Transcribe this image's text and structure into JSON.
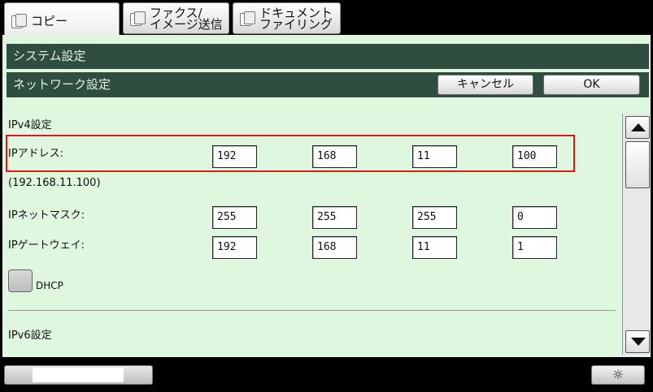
{
  "tabs": [
    {
      "label": "コピー"
    },
    {
      "label": "ファクス/\nイメージ送信"
    },
    {
      "label": "ドキュメント\nファイリング"
    }
  ],
  "header": {
    "system_settings": "システム設定",
    "network_settings": "ネットワーク設定",
    "cancel_label": "キャンセル",
    "ok_label": "OK"
  },
  "ipv4": {
    "section_title": "IPv4設定",
    "ip_address_label": "IPアドレス:",
    "ip_address": [
      "192",
      "168",
      "11",
      "100"
    ],
    "ip_address_display": "(192.168.11.100)",
    "subnet_mask_label": "IPネットマスク:",
    "subnet_mask": [
      "255",
      "255",
      "255",
      "0"
    ],
    "gateway_label": "IPゲートウェイ:",
    "gateway": [
      "192",
      "168",
      "11",
      "1"
    ],
    "dhcp_label": "DHCP"
  },
  "ipv6": {
    "section_title": "IPv6設定"
  },
  "icons": {
    "copy_tab": "copy-icon",
    "fax_tab": "fax-icon",
    "filing_tab": "filing-icon",
    "scroll_up": "arrow-up-icon",
    "scroll_down": "arrow-down-icon",
    "brightness": "brightness-icon"
  },
  "colors": {
    "panel_bg": "#dff7df",
    "title_bar_bg": "#2f4e40",
    "highlight": "#e01818"
  }
}
